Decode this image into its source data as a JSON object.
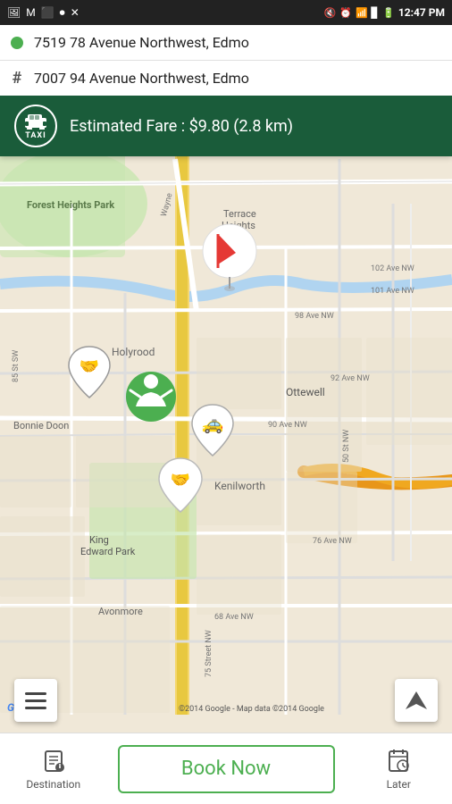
{
  "status_bar": {
    "time": "12:47 PM",
    "icons_left": [
      "image-icon",
      "gmail-icon",
      "bbm-icon",
      "voicemail-icon",
      "x-icon"
    ],
    "icons_right": [
      "mute-icon",
      "alarm-icon",
      "wifi-icon",
      "signal-icon",
      "battery-icon"
    ]
  },
  "inputs": {
    "origin": {
      "value": "7519 78 Avenue Northwest, Edmo",
      "indicator": "dot"
    },
    "destination": {
      "value": "7007 94 Avenue Northwest, Edmo",
      "indicator": "hash"
    }
  },
  "fare_banner": {
    "vehicle_type": "TAXI",
    "fare_text": "Estimated Fare : $9.80 (2.8 km)"
  },
  "map": {
    "copyright": "©2014 Google - Map data ©2014 Google",
    "areas": [
      "Forest Heights Park",
      "Terrace Heights",
      "Holyrood",
      "Bonnie Doon",
      "Kenilworth",
      "King Edward Park",
      "Avonmore",
      "Ottewell"
    ],
    "streets": [
      "Wayne",
      "98 Ave NW",
      "102 Ave NW",
      "101 Ave NW",
      "92 Ave NW",
      "90 Ave NW",
      "76 Ave NW",
      "68 Ave NW",
      "85 St SW",
      "50 St NW",
      "75 Street NW"
    ]
  },
  "controls": {
    "menu_button": "☰",
    "nav_button": "➤"
  },
  "bottom_nav": {
    "destination_label": "Destination",
    "book_now_label": "Book Now",
    "later_label": "Later"
  }
}
